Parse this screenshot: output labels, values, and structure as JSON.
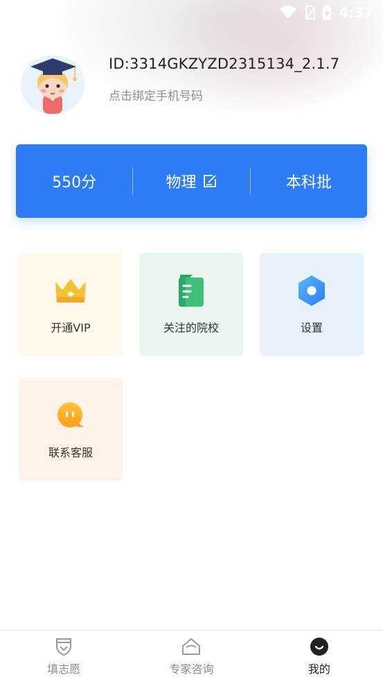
{
  "status_bar": {
    "time": "4:37",
    "icons": [
      "wifi-icon",
      "sim-icon",
      "battery-icon"
    ]
  },
  "profile": {
    "user_id": "ID:3314GKZYZD2315134_2.1.7",
    "bind_phone": "点击绑定手机号码",
    "avatar": "graduate-avatar"
  },
  "score_card": {
    "score": "550分",
    "subject": "物理",
    "batch": "本科批",
    "edit_icon": "edit-icon",
    "accent": "#2d7cf6"
  },
  "tiles": [
    {
      "label": "开通VIP",
      "icon": "crown-icon",
      "bg": "#fff9ec"
    },
    {
      "label": "关注的院校",
      "icon": "document-icon",
      "bg": "#e9f6ee"
    },
    {
      "label": "设置",
      "icon": "hexagon-settings-icon",
      "bg": "#e7f2fc"
    },
    {
      "label": "联系客服",
      "icon": "chat-bubble-icon",
      "bg": "#fff3e9"
    }
  ],
  "tab_bar": {
    "tabs": [
      {
        "label": "填志愿",
        "icon": "shield-badge-icon",
        "active": false
      },
      {
        "label": "专家咨询",
        "icon": "house-icon",
        "active": false
      },
      {
        "label": "我的",
        "icon": "smile-face-icon",
        "active": true
      }
    ]
  }
}
